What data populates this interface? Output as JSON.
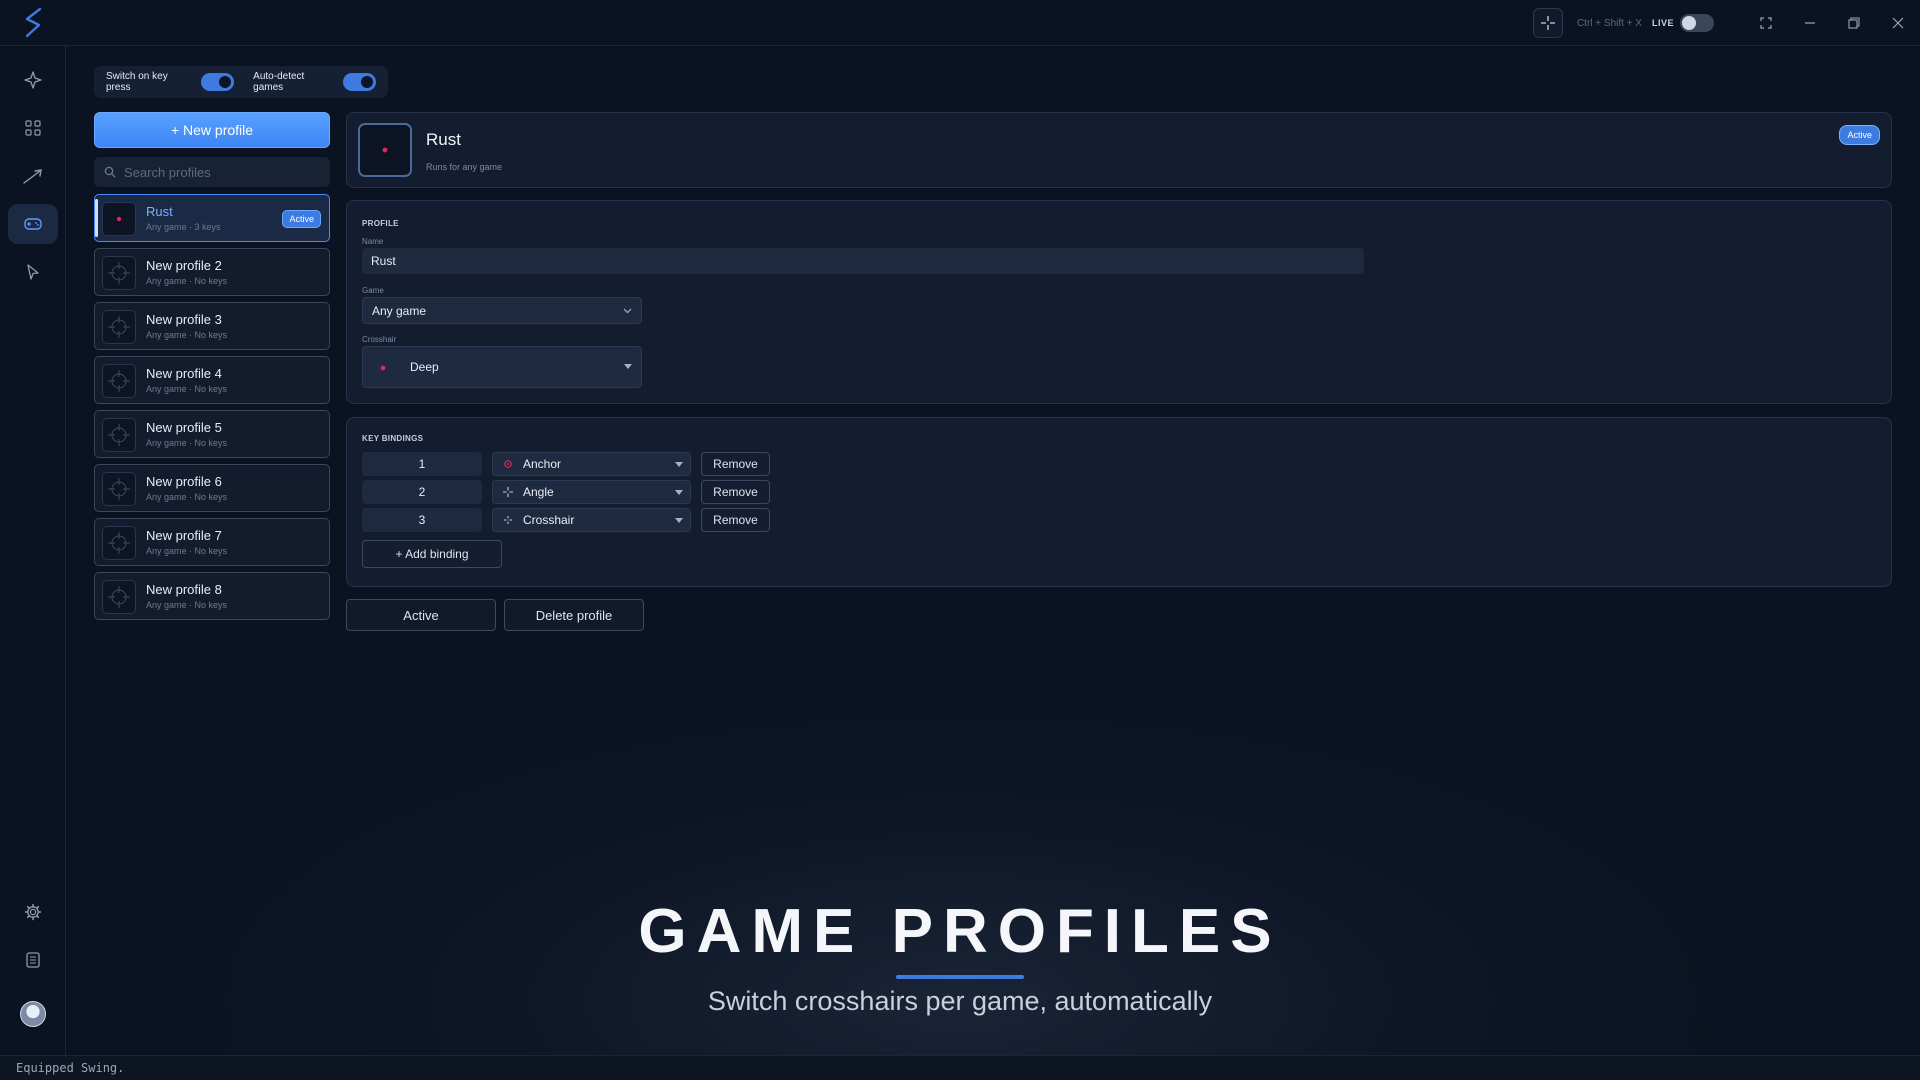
{
  "titlebar": {
    "hotkey": "Ctrl + Shift + X",
    "live_label": "LIVE",
    "icons": [
      "crosshair-icon",
      "fullscreen-icon",
      "minimize-icon",
      "restore-icon",
      "close-icon"
    ]
  },
  "rail": {
    "items": [
      "sparkle-icon",
      "grid-icon",
      "brush-icon",
      "gamepad-icon",
      "cursor-icon"
    ],
    "bottom": [
      "gear-icon",
      "document-icon",
      "avatar"
    ],
    "active": "gamepad-icon"
  },
  "toggles": {
    "switch_on_key": "Switch on key press",
    "auto_detect": "Auto-detect games",
    "switch_on_key_on": true,
    "auto_detect_on": true
  },
  "sidebar": {
    "new_profile": "+ New profile",
    "search_placeholder": "Search profiles",
    "profiles": [
      {
        "name": "Rust",
        "sub": "Any game · 3 keys",
        "badge": "Active"
      },
      {
        "name": "New profile 2",
        "sub": "Any game · No keys"
      },
      {
        "name": "New profile 3",
        "sub": "Any game · No keys"
      },
      {
        "name": "New profile 4",
        "sub": "Any game · No keys"
      },
      {
        "name": "New profile 5",
        "sub": "Any game · No keys"
      },
      {
        "name": "New profile 6",
        "sub": "Any game · No keys"
      },
      {
        "name": "New profile 7",
        "sub": "Any game · No keys"
      },
      {
        "name": "New profile 8",
        "sub": "Any game · No keys"
      }
    ]
  },
  "header": {
    "title": "Rust",
    "subtitle": "Runs for any game",
    "badge": "Active"
  },
  "profile_section": {
    "label": "PROFILE",
    "name_label": "Name",
    "name_value": "Rust",
    "game_label": "Game",
    "game_value": "Any game",
    "crosshair_label": "Crosshair",
    "crosshair_value": "Deep"
  },
  "bindings": {
    "label": "KEY BINDINGS",
    "rows": [
      {
        "key": "1",
        "crosshair": "Anchor",
        "remove": "Remove"
      },
      {
        "key": "2",
        "crosshair": "Angle",
        "remove": "Remove"
      },
      {
        "key": "3",
        "crosshair": "Crosshair",
        "remove": "Remove"
      }
    ],
    "add": "+ Add binding"
  },
  "actions": {
    "active": "Active",
    "delete": "Delete profile"
  },
  "hero": {
    "title": "GAME PROFILES",
    "subtitle": "Switch crosshairs per game, automatically"
  },
  "status": "Equipped Swing.",
  "colors": {
    "accent": "#3d7be0",
    "crosshair_dot": "#e0245e"
  }
}
